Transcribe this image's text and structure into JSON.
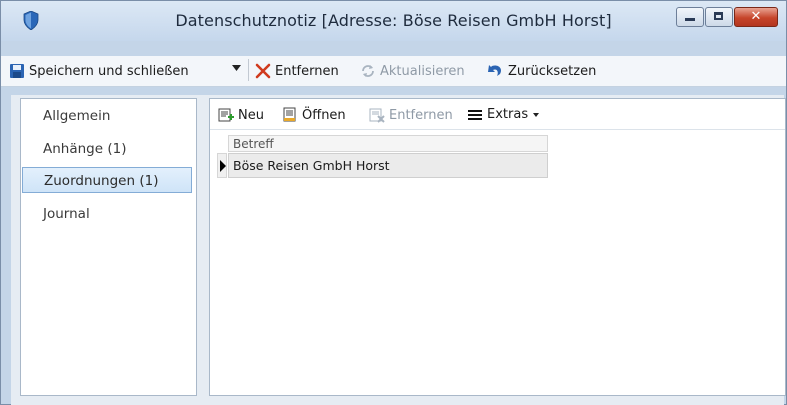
{
  "window": {
    "title": "Datenschutznotiz [Adresse: Böse Reisen GmbH Horst]",
    "close_glyph": "✕"
  },
  "toolbar": {
    "save_close": "Speichern und schließen",
    "remove": "Entfernen",
    "refresh": "Aktualisieren",
    "reset": "Zurücksetzen"
  },
  "nav": {
    "items": [
      {
        "label": "Allgemein"
      },
      {
        "label": "Anhänge  (1)"
      },
      {
        "label": "Zuordnungen  (1)"
      },
      {
        "label": "Journal"
      }
    ]
  },
  "grid_toolbar": {
    "new": "Neu",
    "open": "Öffnen",
    "remove": "Entfernen",
    "extras": "Extras"
  },
  "grid": {
    "column_header": "Betreff",
    "rows": [
      {
        "betreff": "Böse Reisen GmbH Horst"
      }
    ]
  },
  "colors": {
    "accent_red": "#d03a1e",
    "accent_blue": "#2b64b3",
    "selection": "#cfe4f8"
  }
}
